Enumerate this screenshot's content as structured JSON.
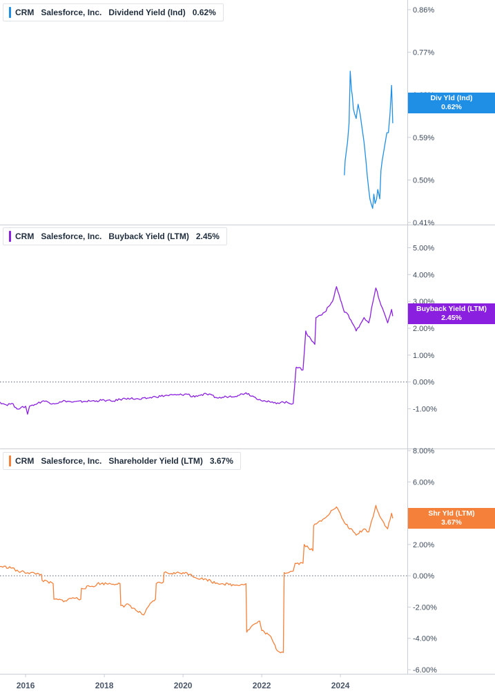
{
  "chart_data": [
    {
      "type": "line",
      "ticker": "CRM",
      "company": "Salesforce, Inc.",
      "metric": "Dividend Yield (Ind)",
      "current_value": "0.62%",
      "tag_label": "Div Yld (Ind)",
      "tag_value": "0.62%",
      "color": "#1f8fe6",
      "ylim": [
        0.41,
        0.86
      ],
      "yticks": [
        0.86,
        0.77,
        0.68,
        0.59,
        0.5,
        0.41
      ],
      "ytick_labels": [
        "0.86%",
        "0.77%",
        "0.68%",
        "0.59%",
        "0.50%",
        "0.41%"
      ],
      "zero_line": false,
      "series": [
        {
          "x": [
            2024.1,
            2024.12,
            2024.15,
            2024.18,
            2024.2,
            2024.22,
            2024.25,
            2024.28,
            2024.3,
            2024.33,
            2024.36,
            2024.4,
            2024.45,
            2024.5,
            2024.55,
            2024.6,
            2024.65,
            2024.68,
            2024.72,
            2024.75,
            2024.78,
            2024.82,
            2024.85,
            2024.88,
            2024.92,
            2024.95,
            2025.0,
            2025.03,
            2025.06,
            2025.1,
            2025.14,
            2025.18,
            2025.22,
            2025.26,
            2025.3,
            2025.33
          ],
          "y": [
            0.51,
            0.54,
            0.56,
            0.58,
            0.6,
            0.62,
            0.73,
            0.69,
            0.68,
            0.65,
            0.64,
            0.63,
            0.66,
            0.64,
            0.61,
            0.58,
            0.54,
            0.51,
            0.48,
            0.46,
            0.45,
            0.44,
            0.47,
            0.45,
            0.46,
            0.48,
            0.46,
            0.52,
            0.54,
            0.56,
            0.58,
            0.6,
            0.6,
            0.64,
            0.7,
            0.62
          ]
        }
      ]
    },
    {
      "type": "line",
      "ticker": "CRM",
      "company": "Salesforce, Inc.",
      "metric": "Buyback Yield (LTM)",
      "current_value": "2.45%",
      "tag_label": "Buyback Yield (LTM)",
      "tag_value": "2.45%",
      "color": "#8a1fe0",
      "ylim": [
        -1.5,
        5.5
      ],
      "yticks": [
        5,
        4,
        3,
        2,
        1,
        0,
        -1
      ],
      "ytick_labels": [
        "5.00%",
        "4.00%",
        "3.00%",
        "2.00%",
        "1.00%",
        "0.00%",
        "-1.00%"
      ],
      "zero_line": true,
      "series": [
        {
          "x": [
            2015.35,
            2015.5,
            2015.65,
            2015.75,
            2015.85,
            2016.0,
            2016.05,
            2016.1,
            2016.3,
            2016.45,
            2016.7,
            2016.9,
            2017.0,
            2017.2,
            2017.5,
            2017.8,
            2018.0,
            2018.2,
            2018.4,
            2018.6,
            2018.9,
            2019.1,
            2019.3,
            2019.6,
            2019.9,
            2020.15,
            2020.2,
            2020.4,
            2020.6,
            2020.9,
            2021.1,
            2021.4,
            2021.6,
            2021.8,
            2021.95,
            2022.1,
            2022.3,
            2022.55,
            2022.8,
            2022.87,
            2022.88,
            2023.05,
            2023.12,
            2023.14,
            2023.35,
            2023.38,
            2023.6,
            2023.8,
            2023.9,
            2024.1,
            2024.2,
            2024.4,
            2024.6,
            2024.72,
            2024.9,
            2025.0,
            2025.2,
            2025.3,
            2025.33
          ],
          "y": [
            -0.75,
            -0.85,
            -0.8,
            -0.95,
            -1.0,
            -0.9,
            -1.2,
            -0.9,
            -0.8,
            -0.7,
            -0.8,
            -0.75,
            -0.7,
            -0.75,
            -0.72,
            -0.7,
            -0.68,
            -0.72,
            -0.65,
            -0.6,
            -0.65,
            -0.6,
            -0.55,
            -0.5,
            -0.48,
            -0.45,
            -0.55,
            -0.5,
            -0.45,
            -0.6,
            -0.55,
            -0.5,
            -0.4,
            -0.55,
            -0.65,
            -0.72,
            -0.78,
            -0.75,
            -0.8,
            0.5,
            0.55,
            0.45,
            1.9,
            1.8,
            1.4,
            2.4,
            2.6,
            3.0,
            3.55,
            2.6,
            2.5,
            1.9,
            2.4,
            2.2,
            3.5,
            3.0,
            2.2,
            2.7,
            2.45
          ]
        }
      ]
    },
    {
      "type": "line",
      "ticker": "CRM",
      "company": "Salesforce, Inc.",
      "metric": "Shareholder Yield (LTM)",
      "current_value": "3.67%",
      "tag_label": "Shr Yld (LTM)",
      "tag_value": "3.67%",
      "color": "#f4803a",
      "ylim": [
        -6.0,
        8.0
      ],
      "yticks": [
        8,
        6,
        4,
        2,
        0,
        -2,
        -4,
        -6
      ],
      "ytick_labels": [
        "8.00%",
        "6.00%",
        "4.00%",
        "2.00%",
        "0.00%",
        "-2.00%",
        "-4.00%",
        "-6.00%"
      ],
      "zero_line": true,
      "series": [
        {
          "x": [
            2015.35,
            2015.7,
            2015.75,
            2016.4,
            2016.42,
            2016.7,
            2016.72,
            2017.0,
            2017.2,
            2017.4,
            2017.42,
            2017.8,
            2017.82,
            2018.4,
            2018.42,
            2018.5,
            2018.6,
            2018.8,
            2019.0,
            2019.2,
            2019.3,
            2019.32,
            2019.5,
            2019.52,
            2019.7,
            2020.0,
            2020.2,
            2020.3,
            2020.7,
            2020.72,
            2021.0,
            2021.3,
            2021.6,
            2021.62,
            2021.75,
            2021.95,
            2022.0,
            2022.2,
            2022.4,
            2022.55,
            2022.57,
            2022.8,
            2022.85,
            2023.05,
            2023.08,
            2023.3,
            2023.32,
            2023.55,
            2023.8,
            2023.9,
            2024.1,
            2024.4,
            2024.6,
            2024.72,
            2024.9,
            2025.0,
            2025.2,
            2025.3,
            2025.33
          ],
          "y": [
            0.6,
            0.5,
            0.3,
            0.1,
            -0.3,
            -0.5,
            -1.5,
            -1.6,
            -1.4,
            -1.5,
            -0.8,
            -0.6,
            -0.5,
            -0.5,
            -1.9,
            -2.0,
            -1.8,
            -2.2,
            -2.5,
            -1.7,
            -1.5,
            -0.5,
            -0.4,
            0.2,
            0.15,
            0.2,
            0.1,
            -0.1,
            -0.3,
            -0.4,
            -0.5,
            -0.6,
            -0.5,
            -3.6,
            -3.2,
            -2.9,
            -3.5,
            -3.8,
            -4.8,
            -4.9,
            0.2,
            0.3,
            0.8,
            0.8,
            2.0,
            1.6,
            3.2,
            3.6,
            4.2,
            4.4,
            3.4,
            2.6,
            3.0,
            2.8,
            4.5,
            3.8,
            3.0,
            4.0,
            3.67
          ]
        }
      ]
    }
  ],
  "x_axis": {
    "xlim": [
      2015.35,
      2025.7
    ],
    "ticks": [
      2016,
      2018,
      2020,
      2022,
      2024
    ],
    "tick_labels": [
      "2016",
      "2018",
      "2020",
      "2022",
      "2024"
    ]
  }
}
